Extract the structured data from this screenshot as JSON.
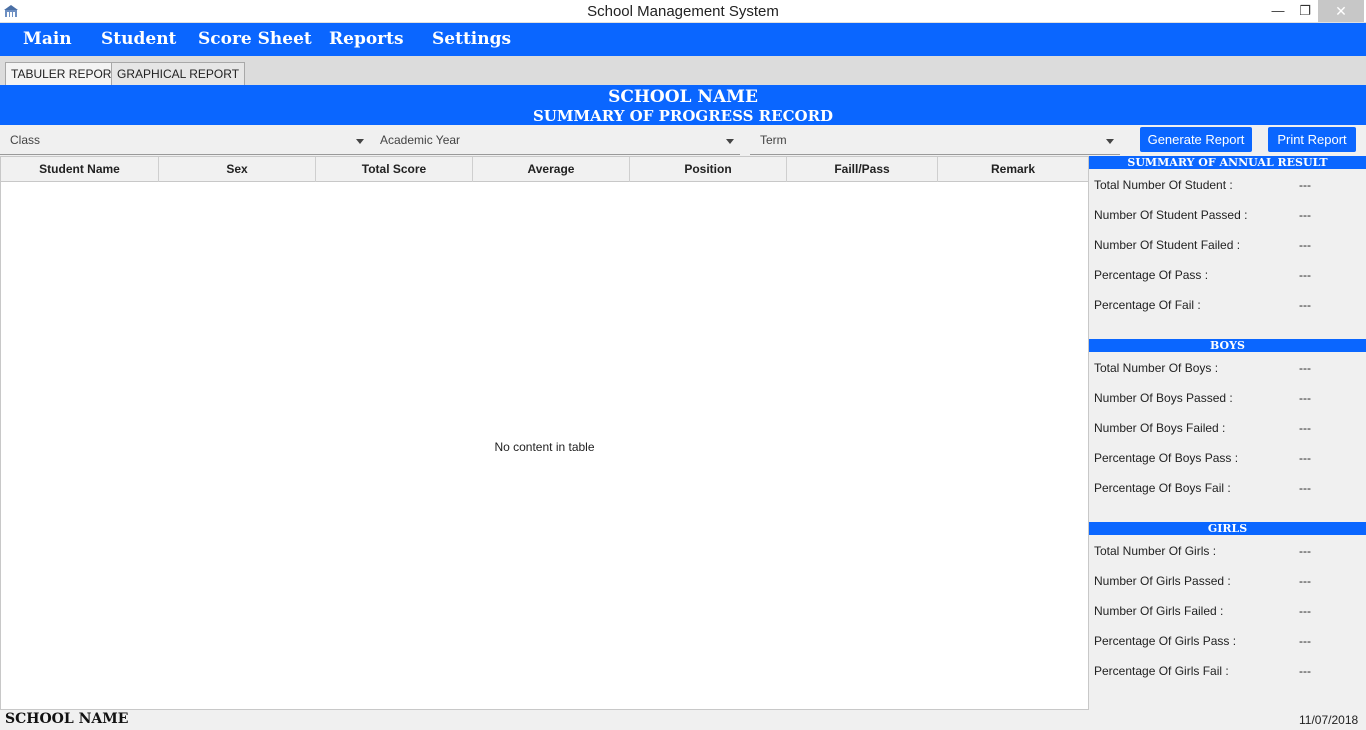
{
  "window": {
    "title": "School Management System",
    "minimize": "—",
    "maximize": "❐",
    "close": "✕"
  },
  "menu": [
    "Main",
    "Student",
    "Score Sheet",
    "Reports",
    "Settings"
  ],
  "tabs": [
    "TABULER REPORT",
    "GRAPHICAL REPORT"
  ],
  "banner": {
    "school_name": "SCHOOL NAME",
    "subtitle": "SUMMARY OF PROGRESS RECORD"
  },
  "filters": {
    "class": "Class",
    "academic_year": "Academic Year",
    "term": "Term"
  },
  "buttons": {
    "generate": "Generate Report",
    "print": "Print Report"
  },
  "table": {
    "columns": [
      "Student Name",
      "Sex",
      "Total Score",
      "Average",
      "Position",
      "Faill/Pass",
      "Remark"
    ],
    "empty_text": "No content in table"
  },
  "summary": {
    "annual": {
      "title": "SUMMARY OF ANNUAL RESULT",
      "rows": [
        {
          "label": "Total Number Of Student :",
          "value": "---"
        },
        {
          "label": "Number Of Student Passed :",
          "value": "---"
        },
        {
          "label": "Number Of Student Failed :",
          "value": "---"
        },
        {
          "label": "Percentage Of Pass :",
          "value": "---"
        },
        {
          "label": "Percentage Of Fail :",
          "value": "---"
        }
      ]
    },
    "boys": {
      "title": "BOYS",
      "rows": [
        {
          "label": "Total Number Of Boys :",
          "value": "---"
        },
        {
          "label": "Number Of Boys Passed :",
          "value": "---"
        },
        {
          "label": "Number Of Boys Failed :",
          "value": "---"
        },
        {
          "label": "Percentage Of Boys Pass :",
          "value": "---"
        },
        {
          "label": "Percentage Of Boys Fail :",
          "value": "---"
        }
      ]
    },
    "girls": {
      "title": "GIRLS",
      "rows": [
        {
          "label": "Total Number Of Girls :",
          "value": "---"
        },
        {
          "label": "Number Of Girls Passed :",
          "value": "---"
        },
        {
          "label": "Number Of Girls Failed :",
          "value": "---"
        },
        {
          "label": "Percentage Of Girls Pass :",
          "value": "---"
        },
        {
          "label": "Percentage Of Girls Fail :",
          "value": "---"
        }
      ]
    }
  },
  "footer": {
    "school_name": "SCHOOL NAME",
    "date": "11/07/2018"
  },
  "colors": {
    "accent": "#0a66ff"
  }
}
